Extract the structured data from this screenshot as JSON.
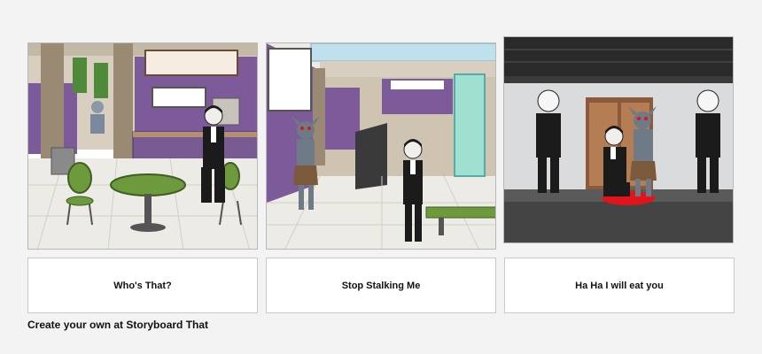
{
  "panels": [
    {
      "caption": "Who's That?"
    },
    {
      "caption": "Stop Stalking Me"
    },
    {
      "caption": "Ha Ha I will eat you"
    }
  ],
  "footer": {
    "text": "Create your own at Storyboard That"
  },
  "colors": {
    "background": "#f3f3f3",
    "mall_purple": "#7d5a99",
    "table_green": "#6c9a3c",
    "suit_black": "#1b1b1b",
    "demon_skin": "#6e7a86",
    "blood_red": "#e0141a"
  }
}
